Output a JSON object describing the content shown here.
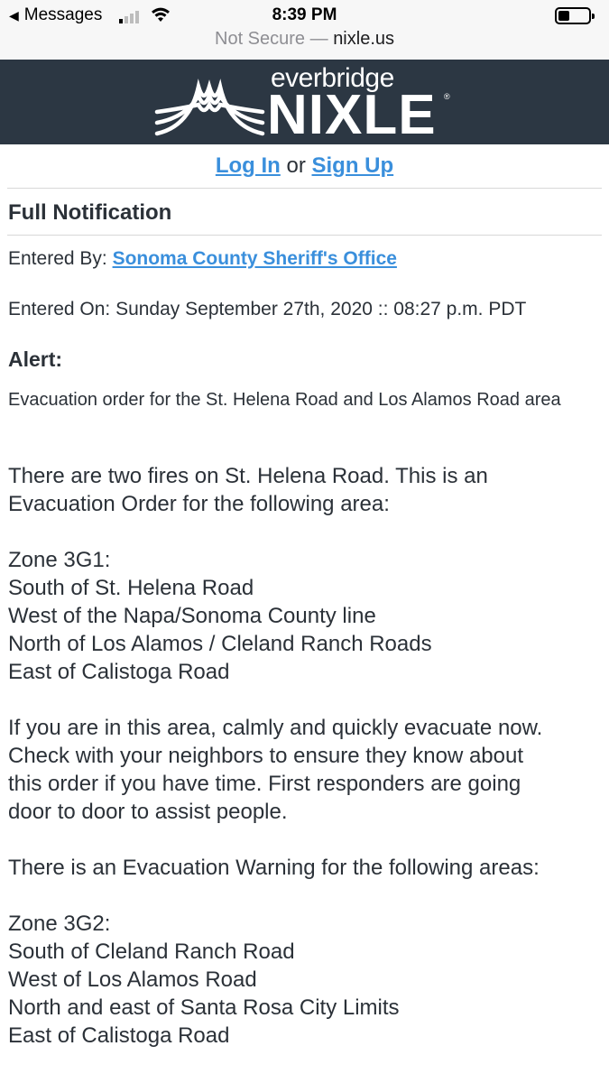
{
  "status_bar": {
    "back_label": "Messages",
    "time": "8:39 PM"
  },
  "url_bar": {
    "security": "Not Secure",
    "separator": " — ",
    "domain": "nixle.us"
  },
  "brand": {
    "top": "everbridge",
    "main": "NIXLE",
    "header_color": "#2c3743",
    "link_color": "#3a8fdc"
  },
  "auth": {
    "login": "Log In",
    "or": " or ",
    "signup": "Sign Up"
  },
  "notification": {
    "heading": "Full Notification",
    "entered_by_label": "Entered By: ",
    "entered_by_value": "Sonoma County Sheriff's Office",
    "entered_on": "Entered On: Sunday September 27th, 2020 :: 08:27 p.m. PDT",
    "alert_label": "Alert:",
    "alert_summary": "Evacuation order for the St. Helena Road and Los Alamos Road area",
    "body_lines": [
      "There are two fires on St. Helena Road. This is an",
      "Evacuation Order for the following area:",
      "",
      "Zone 3G1:",
      "South of St. Helena Road",
      "West of the Napa/Sonoma County line",
      "North of Los Alamos / Cleland Ranch Roads",
      "East of Calistoga Road",
      "",
      "If you are in this area, calmly and quickly evacuate now.",
      "Check with your neighbors to ensure they know about",
      "this order if you have time. First responders are going",
      "door to door to assist people.",
      "",
      "There is an Evacuation Warning for the following areas:",
      "",
      "Zone 3G2:",
      "South of Cleland Ranch Road",
      "West of Los Alamos Road",
      "North and east of Santa Rosa City Limits",
      "East of Calistoga Road"
    ]
  }
}
